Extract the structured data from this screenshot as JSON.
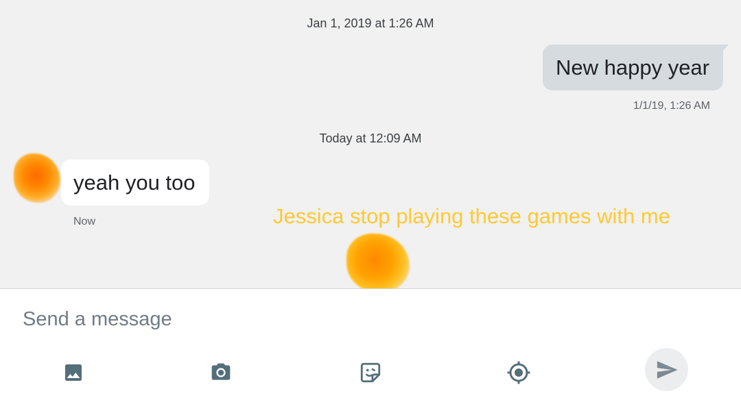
{
  "conversation": {
    "messages": [
      {
        "header": "Jan 1, 2019 at 1:26 AM",
        "direction": "outgoing",
        "text": "New happy year",
        "time": "1/1/19, 1:26 AM"
      },
      {
        "header": "Today at 12:09 AM",
        "direction": "incoming",
        "text": "yeah you too",
        "time": "Now"
      }
    ],
    "overlay_caption": "Jessica stop playing these games with me"
  },
  "composer": {
    "placeholder": "Send a message",
    "actions": [
      {
        "icon": "image-icon",
        "label": "Gallery"
      },
      {
        "icon": "camera-icon",
        "label": "Camera"
      },
      {
        "icon": "sticker-icon",
        "label": "Stickers"
      },
      {
        "icon": "location-icon",
        "label": "Location"
      }
    ],
    "send_icon": "send-icon"
  },
  "colors": {
    "thread_background": "#f1f1f1",
    "outgoing_bubble": "#d6dbdf",
    "incoming_bubble": "#ffffff",
    "icon": "#546e7a",
    "overlay_text": "#ffc933"
  }
}
